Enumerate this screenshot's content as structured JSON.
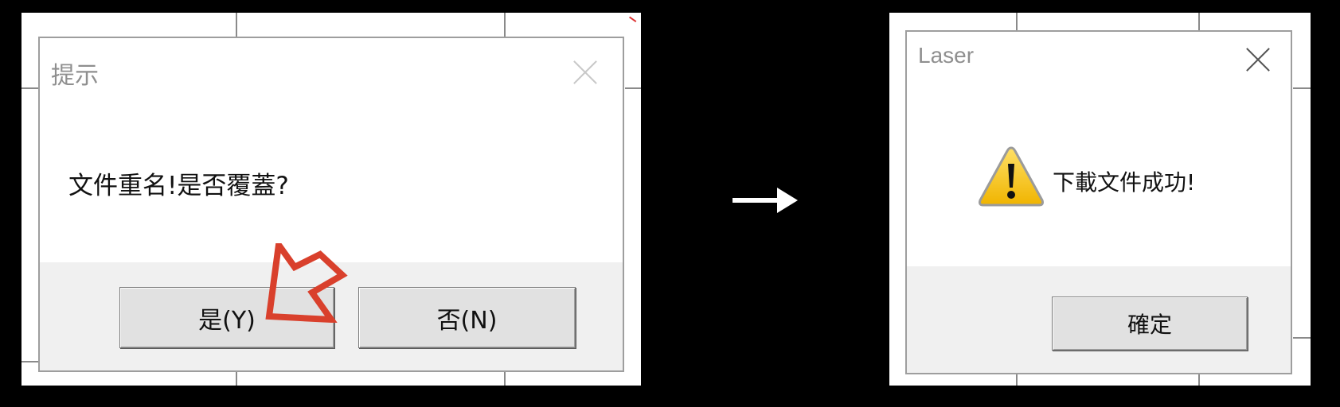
{
  "left": {
    "title": "提示",
    "message": "文件重名!是否覆蓋?",
    "buttons": {
      "yes": "是(Y)",
      "no": "否(N)"
    }
  },
  "right": {
    "title": "Laser",
    "message": "下載文件成功!",
    "buttons": {
      "ok": "確定"
    }
  },
  "icons": {
    "close": "close-icon",
    "warning": "warning-icon",
    "pointer": "pointer-arrow-icon",
    "flow": "right-arrow-icon"
  },
  "colors": {
    "annotation": "#d9402c",
    "dialog_footer": "#f0f0f0",
    "button": "#e1e1e1"
  }
}
